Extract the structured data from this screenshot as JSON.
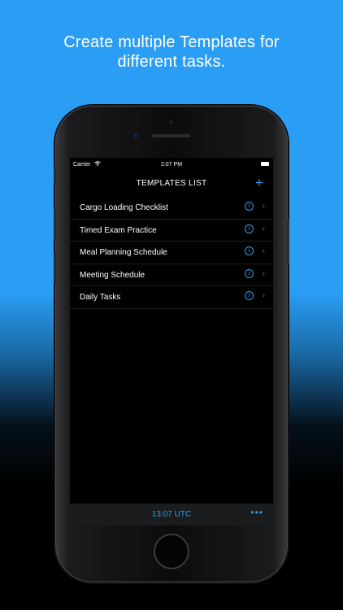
{
  "headline": [
    "Create multiple Templates for",
    "different tasks."
  ],
  "status_bar": {
    "carrier": "Carrier",
    "wifi_icon": "wifi-icon",
    "time": "2:07 PM",
    "battery_icon": "battery-icon"
  },
  "navbar": {
    "title": "TEMPLATES LIST",
    "add_label": "+"
  },
  "templates": [
    {
      "label": "Cargo Loading Checklist"
    },
    {
      "label": "Timed Exam Practice"
    },
    {
      "label": "Meal Planning Schedule"
    },
    {
      "label": "Meeting Schedule"
    },
    {
      "label": "Daily Tasks"
    }
  ],
  "row_info_glyph": "i",
  "row_chevron_glyph": "›",
  "bottom_bar": {
    "utc_time": "13:07 UTC",
    "more_label": "•••"
  },
  "colors": {
    "accent": "#2a9df4",
    "background_top": "#2a9df4",
    "screen_bg": "#000000",
    "bottom_bar_bg": "#1a1c1e"
  }
}
